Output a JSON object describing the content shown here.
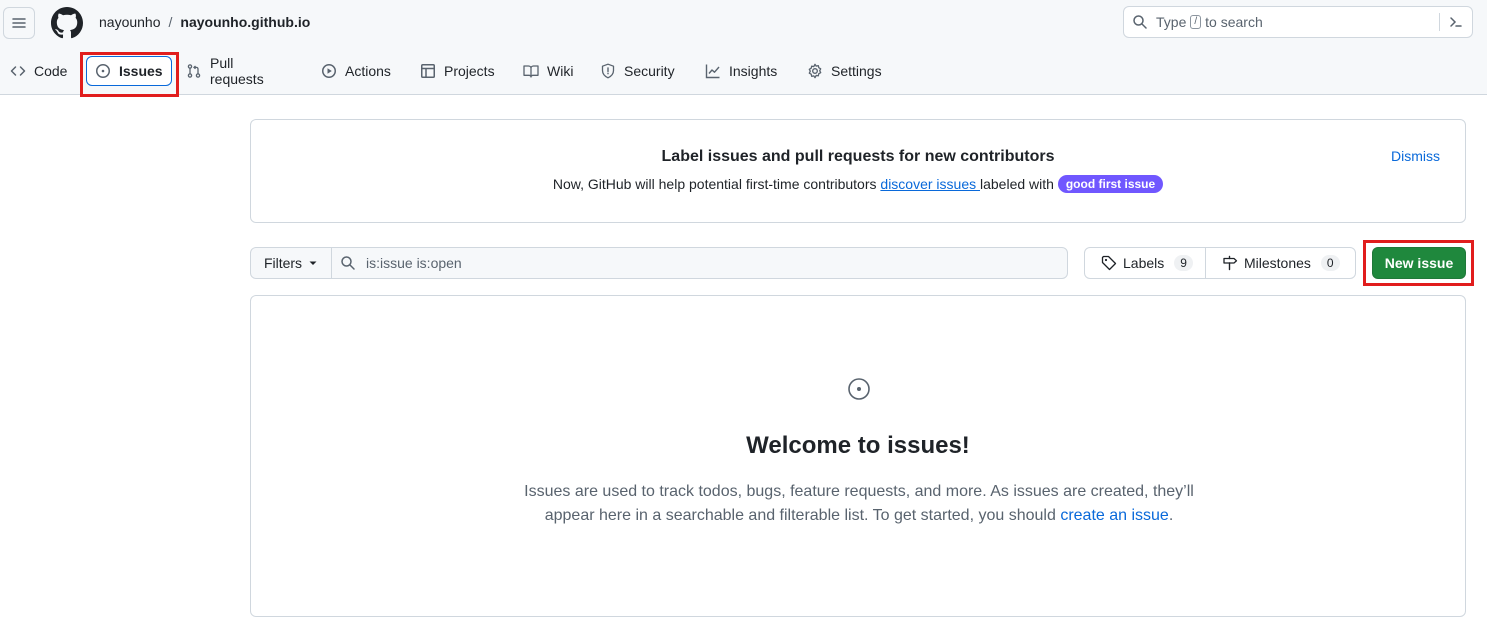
{
  "header": {
    "owner": "nayounho",
    "separator": "/",
    "repo": "nayounho.github.io",
    "search": {
      "prefix": "Type",
      "key": "/",
      "suffix": "to search"
    }
  },
  "tabs": [
    {
      "label": "Code",
      "icon": "code-icon"
    },
    {
      "label": "Issues",
      "icon": "issue-opened-icon",
      "active": true
    },
    {
      "label": "Pull requests",
      "icon": "git-pull-request-icon"
    },
    {
      "label": "Actions",
      "icon": "play-icon"
    },
    {
      "label": "Projects",
      "icon": "table-icon"
    },
    {
      "label": "Wiki",
      "icon": "book-icon"
    },
    {
      "label": "Security",
      "icon": "shield-icon"
    },
    {
      "label": "Insights",
      "icon": "graph-icon"
    },
    {
      "label": "Settings",
      "icon": "gear-icon"
    }
  ],
  "banner": {
    "title": "Label issues and pull requests for new contributors",
    "desc_before": "Now, GitHub will help potential first-time contributors ",
    "desc_link": "discover issues ",
    "desc_after": "labeled with ",
    "pill": "good first issue",
    "dismiss": "Dismiss"
  },
  "filters": {
    "button": "Filters",
    "query": "is:issue is:open",
    "labels": "Labels",
    "labels_count": "9",
    "milestones": "Milestones",
    "milestones_count": "0",
    "new_issue": "New issue"
  },
  "empty_state": {
    "heading": "Welcome to issues!",
    "body_before": "Issues are used to track todos, bugs, feature requests, and more. As issues are created, they’ll appear here in a searchable and filterable list. To get started, you should ",
    "link": "create an issue",
    "body_after": "."
  },
  "colors": {
    "accent": "#0969da",
    "primary_button": "#1f883d",
    "pill": "#7057ff",
    "highlight": "#e11d1d"
  }
}
